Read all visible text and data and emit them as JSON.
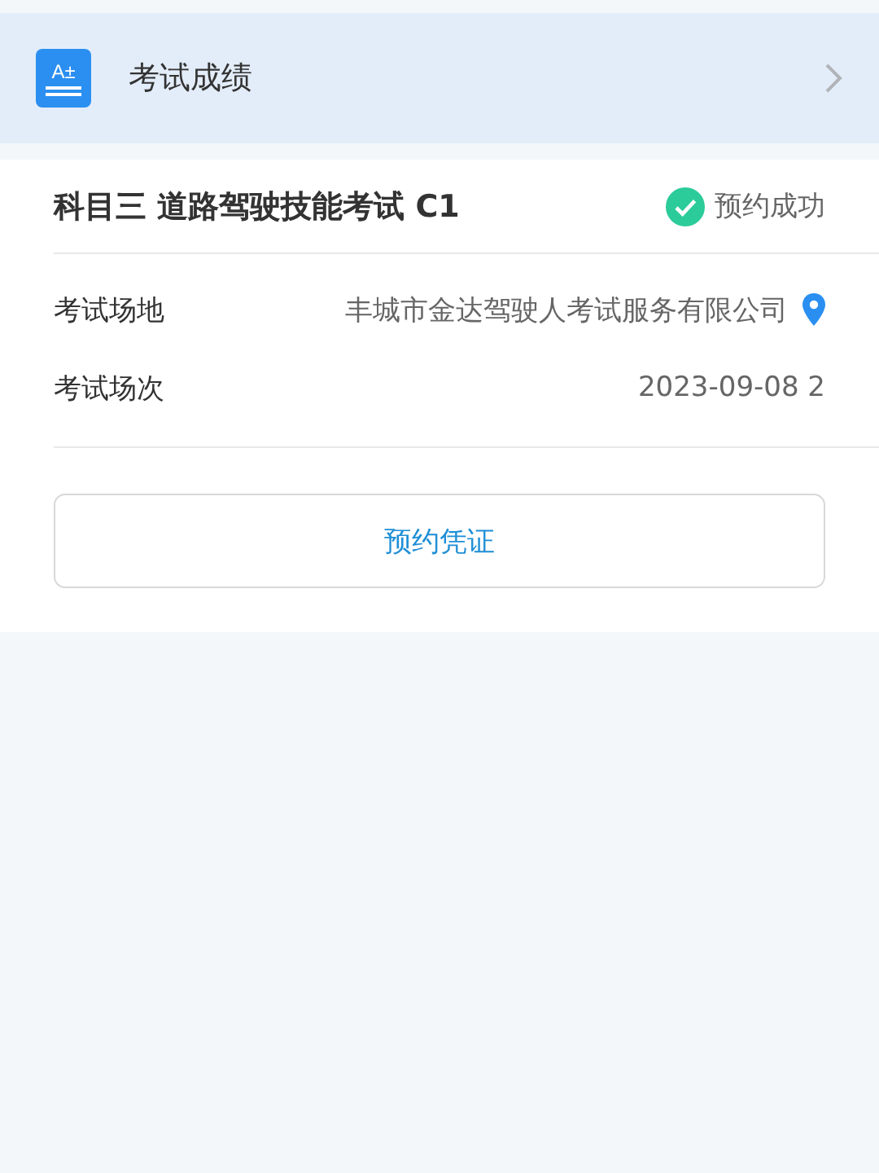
{
  "header": {
    "icon_text": "A±",
    "title": "考试成绩"
  },
  "exam": {
    "title": "科目三 道路驾驶技能考试 C1",
    "status": "预约成功",
    "rows": [
      {
        "label": "考试场地",
        "value": "丰城市金达驾驶人考试服务有限公司",
        "kind": "location"
      },
      {
        "label": "考试场次",
        "value": "2023-09-08 2",
        "kind": "plain"
      }
    ],
    "button": "预约凭证"
  }
}
